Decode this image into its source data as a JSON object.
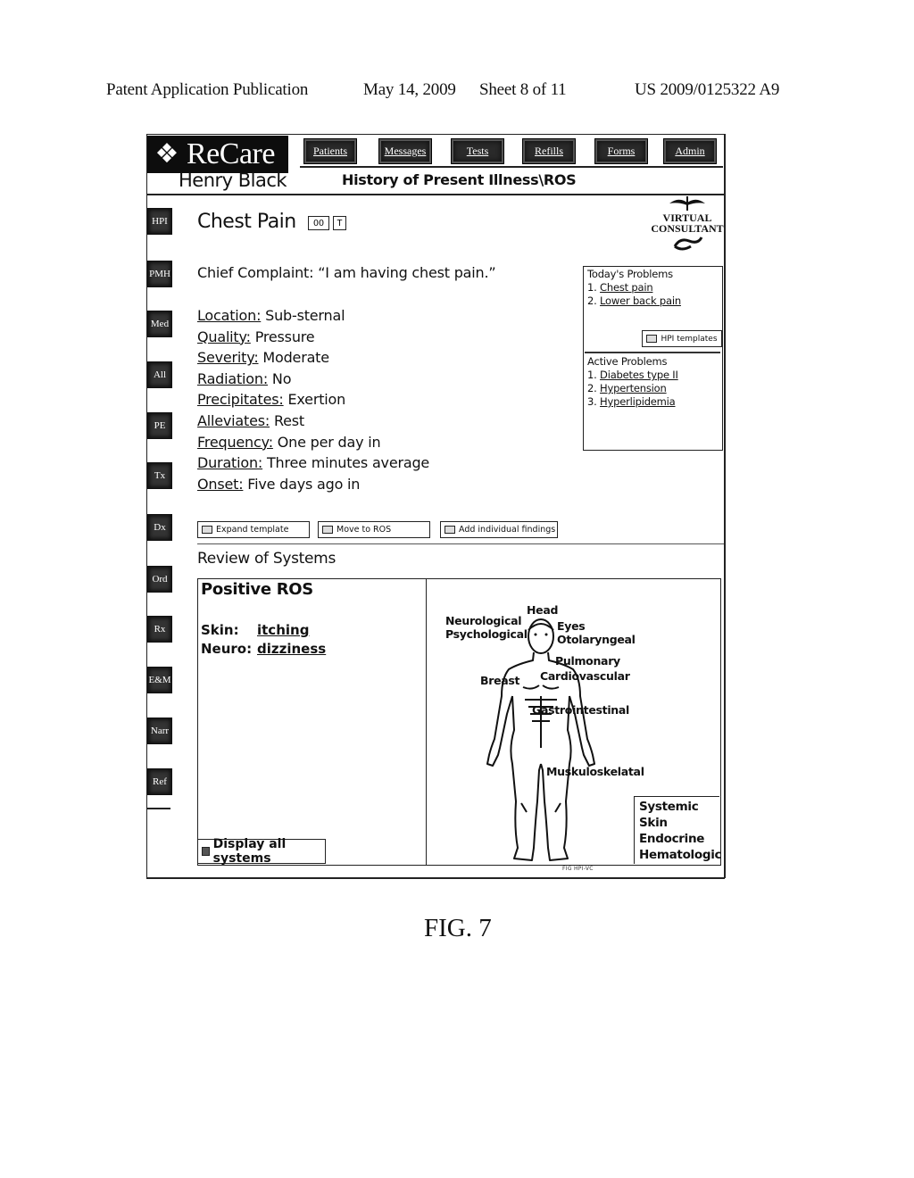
{
  "patent_header": {
    "publication": "Patent Application Publication",
    "date": "May 14, 2009",
    "sheet": "Sheet 8 of 11",
    "number": "US 2009/0125322 A9"
  },
  "app": {
    "logo_icon": "celtic-knot-icon",
    "name": "ReCare",
    "nav": [
      {
        "label": "Patients"
      },
      {
        "label": "Messages"
      },
      {
        "label": "Tests"
      },
      {
        "label": "Refills"
      },
      {
        "label": "Forms"
      },
      {
        "label": "Admin"
      }
    ],
    "patient_name": "Henry Black",
    "section_title": "History of Present Illness\\ROS"
  },
  "sidebar": {
    "items": [
      {
        "label": "HPI"
      },
      {
        "label": "PMH"
      },
      {
        "label": "Med"
      },
      {
        "label": "All"
      },
      {
        "label": "PE"
      },
      {
        "label": "Tx"
      },
      {
        "label": "Dx"
      },
      {
        "label": "Ord"
      },
      {
        "label": "Rx"
      },
      {
        "label": "E&M"
      },
      {
        "label": "Narr"
      },
      {
        "label": "Ref"
      }
    ]
  },
  "complaint": {
    "title": "Chest Pain",
    "icon_buttons": [
      {
        "label": "OO",
        "icon": "glasses-icon"
      },
      {
        "label": "T",
        "icon": "text-icon"
      }
    ],
    "virtual_consultant": {
      "line1": "VIRTUAL",
      "line2": "CONSULTANT"
    },
    "chief_complaint_label": "Chief Complaint:",
    "chief_complaint_value": "“I am having chest pain.”"
  },
  "hpi_fields": [
    {
      "label": "Location:",
      "value": "Sub-sternal"
    },
    {
      "label": "Quality:",
      "value": "Pressure"
    },
    {
      "label": "Severity:",
      "value": "Moderate"
    },
    {
      "label": "Radiation:",
      "value": "No"
    },
    {
      "label": "Precipitates:",
      "value": "Exertion"
    },
    {
      "label": "Alleviates:",
      "value": "Rest"
    },
    {
      "label": "Frequency:",
      "value": "One per day in"
    },
    {
      "label": "Duration:",
      "value": "Three minutes average"
    },
    {
      "label": "Onset:",
      "value": "Five days ago in"
    }
  ],
  "problems": {
    "today_title": "Today's Problems",
    "today": [
      {
        "num": "1.",
        "label": "Chest pain"
      },
      {
        "num": "2.",
        "label": "Lower back pain"
      }
    ],
    "hpi_templates_button": "HPI templates",
    "active_title": "Active Problems",
    "active": [
      {
        "num": "1.",
        "label": "Diabetes type II"
      },
      {
        "num": "2.",
        "label": "Hypertension"
      },
      {
        "num": "3.",
        "label": "Hyperlipidemia"
      }
    ]
  },
  "actions": {
    "expand_template": "Expand template",
    "move_to_ros": "Move to ROS",
    "add_findings": "Add individual findings"
  },
  "ros": {
    "title": "Review of Systems",
    "positive_title": "Positive ROS",
    "positive": [
      {
        "system": "Skin:",
        "finding": "itching"
      },
      {
        "system": "Neuro:",
        "finding": "dizziness"
      }
    ],
    "display_all_button": "Display all systems",
    "body_labels": {
      "head": "Head",
      "neurological": "Neurological",
      "psychological": "Psychological",
      "eyes": "Eyes",
      "otolaryngeal": "Otolaryngeal",
      "pulmonary": "Pulmonary",
      "cardiovascular": "Cardiovascular",
      "breast": "Breast",
      "gastrointestinal": "Gastrointestinal",
      "musculoskeletal": "Muskuloskelatal"
    },
    "other_systems": [
      "Systemic",
      "Skin",
      "Endocrine",
      "Hematologic"
    ],
    "figure_tag": "FIG HPI-VC"
  },
  "figure_caption": "FIG. 7"
}
